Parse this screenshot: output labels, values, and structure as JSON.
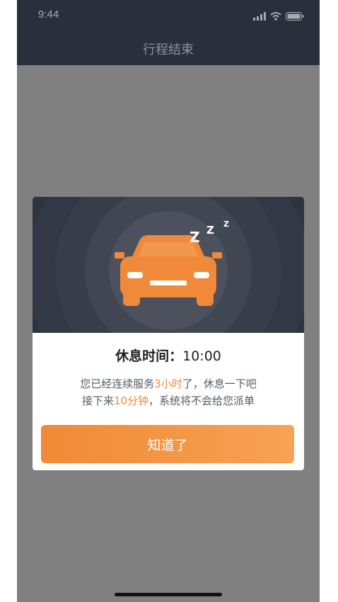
{
  "status_bar": {
    "time": "9:44"
  },
  "header": {
    "title": "行程结束"
  },
  "dialog": {
    "title_prefix": "休息时间：",
    "title_time": "10:00",
    "line1_before": "您已经连续服务",
    "line1_highlight": "3小时",
    "line1_after": "了，休息一下吧",
    "line2_before": "接下来",
    "line2_highlight": "10分钟",
    "line2_after": "，系统将不会给您派单",
    "button_label": "知道了",
    "sleep_letters": [
      "Z",
      "Z",
      "Z"
    ]
  },
  "colors": {
    "accent": "#f0893a",
    "button_start": "#f08a37",
    "button_end": "#f7a255",
    "header_bg": "#2a2f3d",
    "illustration_bg": "#2e3340"
  },
  "icons": [
    "signal-icon",
    "wifi-icon",
    "battery-icon",
    "sleeping-car-icon"
  ]
}
